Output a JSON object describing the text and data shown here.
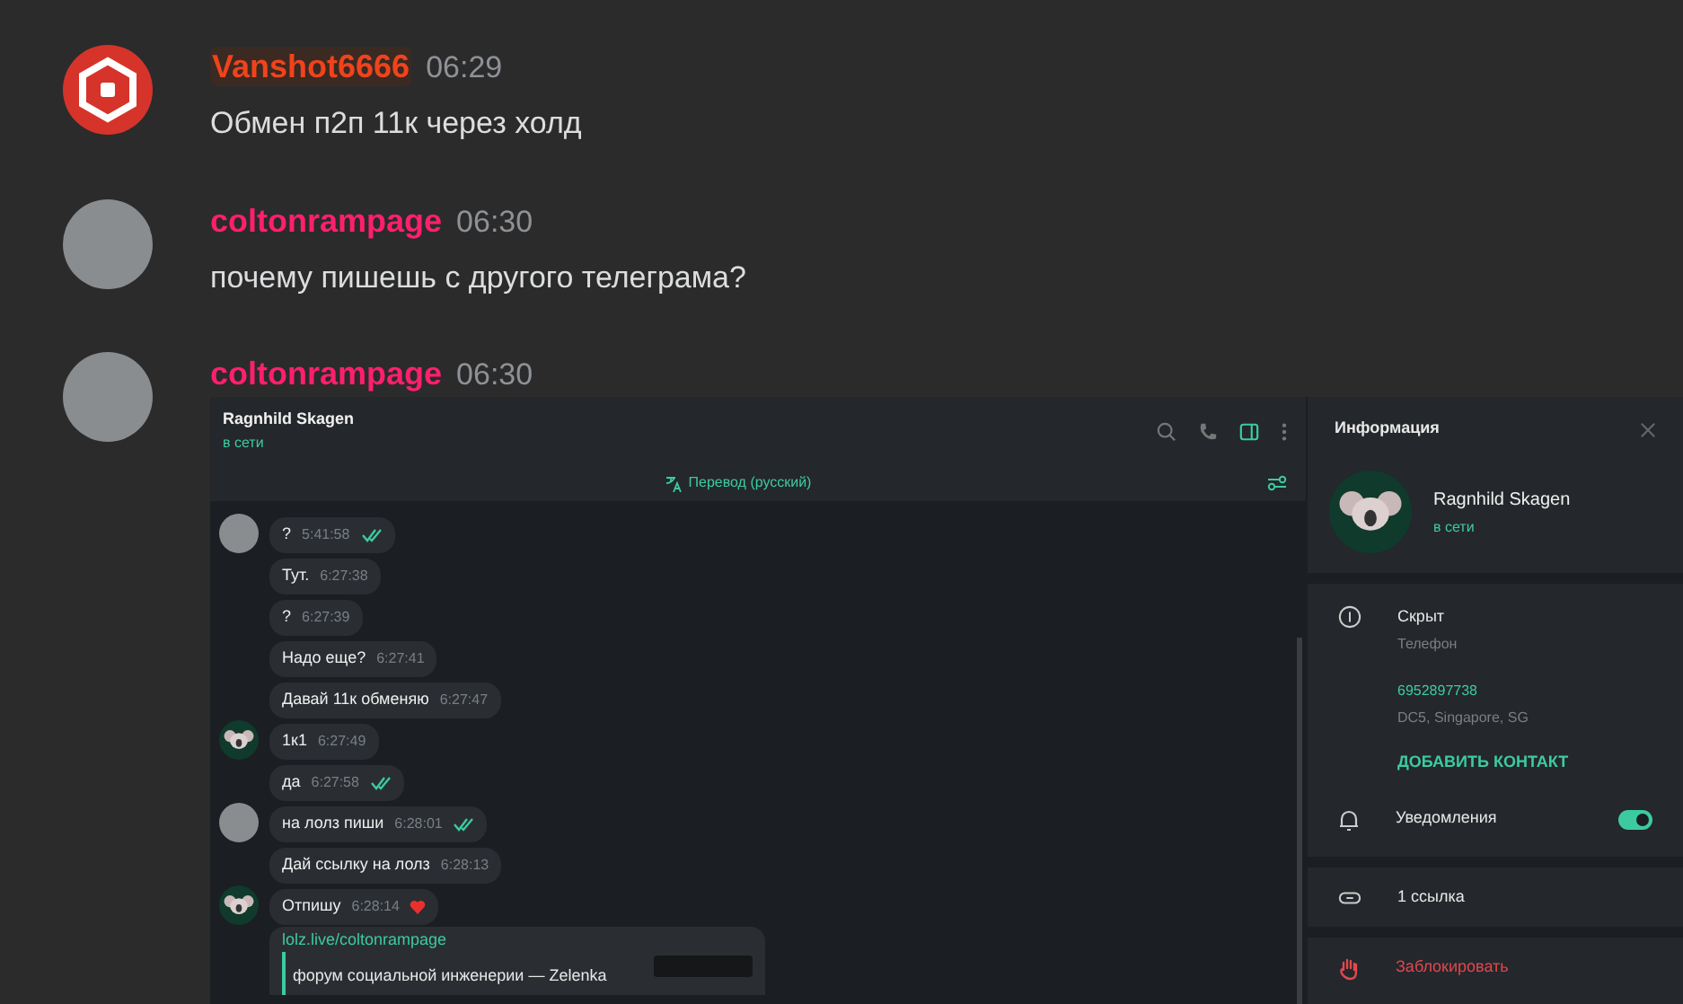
{
  "messages": [
    {
      "author": "Vanshot6666",
      "color": "#f0431c",
      "highlighted": true,
      "time": "06:29",
      "avatar": {
        "kind": "logo"
      },
      "text": "Обмен п2п 11к через холд"
    },
    {
      "author": "coltonrampage",
      "color": "#ff1f6d",
      "highlighted": false,
      "time": "06:30",
      "avatar": {
        "kind": "photo"
      },
      "text": "почему пишешь с другого телеграма?"
    },
    {
      "author": "coltonrampage",
      "color": "#ff1f6d",
      "highlighted": false,
      "time": "06:30",
      "avatar": {
        "kind": "photo"
      }
    }
  ],
  "embedded_screenshot": {
    "chat": {
      "title": "Ragnhild Skagen",
      "status": "в сети",
      "translate_label": "Перевод (русский)",
      "side_panel_open": true,
      "messages": [
        {
          "kind": "text",
          "text": "?",
          "time": "5:41:58",
          "read": true,
          "reacted": false,
          "avatar": {
            "kind": "photo"
          }
        },
        {
          "kind": "text",
          "text": "Тут.",
          "time": "6:27:38",
          "read": false,
          "reacted": false
        },
        {
          "kind": "text",
          "text": "?",
          "time": "6:27:39",
          "read": false,
          "reacted": false
        },
        {
          "kind": "text",
          "text": "Надо еще?",
          "time": "6:27:41",
          "read": false,
          "reacted": false
        },
        {
          "kind": "text",
          "text": "Давай 11к обменяю",
          "time": "6:27:47",
          "read": false,
          "reacted": false
        },
        {
          "kind": "text",
          "text": "1к1",
          "time": "6:27:49",
          "read": false,
          "reacted": false,
          "avatar": {
            "kind": "koala"
          }
        },
        {
          "kind": "text",
          "text": "да",
          "time": "6:27:58",
          "read": true,
          "reacted": false
        },
        {
          "kind": "text",
          "text": "на лолз пиши",
          "time": "6:28:01",
          "read": true,
          "reacted": false,
          "avatar": {
            "kind": "photo"
          }
        },
        {
          "kind": "text",
          "text": "Дай ссылку на лолз",
          "time": "6:28:13",
          "read": false,
          "reacted": false
        },
        {
          "kind": "text",
          "text": "Отпишу",
          "time": "6:28:14",
          "read": false,
          "reacted": true,
          "avatar": {
            "kind": "koala"
          }
        },
        {
          "kind": "link",
          "text": "lolz.live/coltonrampage",
          "preview_title": "форум социальной инженерии — Zelenka"
        }
      ]
    },
    "info_panel": {
      "title": "Информация",
      "name": "Ragnhild Skagen",
      "status": "в сети",
      "phone": "Скрыт",
      "phone_label": "Телефон",
      "number": "6952897738",
      "dc": "DC5, Singapore, SG",
      "add_contact": "ДОБАВИТЬ КОНТАКТ",
      "notifications": "Уведомления",
      "notifications_on": true,
      "links": "1 ссылка",
      "block": "Заблокировать"
    }
  }
}
